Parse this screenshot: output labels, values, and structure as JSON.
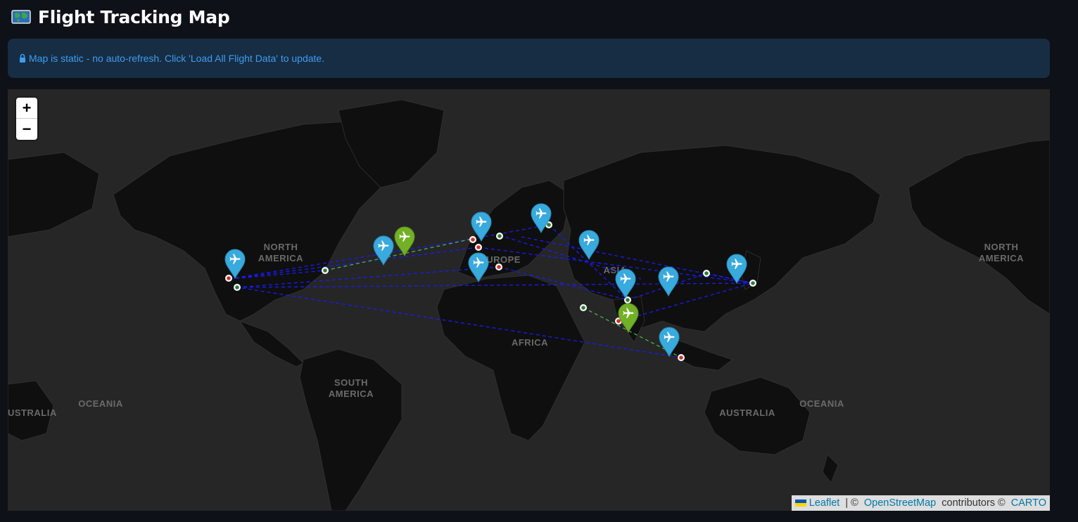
{
  "header": {
    "title": "Flight Tracking Map",
    "icon": "world-map-icon"
  },
  "info": {
    "text": "Map is static - no auto-refresh. Click 'Load All Flight Data' to update.",
    "icon": "lock-icon",
    "color": "#3d9df3"
  },
  "map": {
    "zoom_in_label": "+",
    "zoom_out_label": "−",
    "continent_labels": [
      {
        "lines": [
          "NORTH",
          "AMERICA"
        ],
        "name": "label-north-america-west"
      },
      {
        "lines": [
          "EUROPE"
        ],
        "name": "label-europe"
      },
      {
        "lines": [
          "ASIA"
        ],
        "name": "label-asia"
      },
      {
        "lines": [
          "AFRICA"
        ],
        "name": "label-africa"
      },
      {
        "lines": [
          "SOUTH",
          "AMERICA"
        ],
        "name": "label-south-america"
      },
      {
        "lines": [
          "OCEANIA"
        ],
        "name": "label-oceania-west"
      },
      {
        "lines": [
          "AUSTRALIA"
        ],
        "name": "label-australia"
      },
      {
        "lines": [
          "OCEANIA"
        ],
        "name": "label-oceania-east"
      },
      {
        "lines": [
          "NORTH",
          "AMERICA"
        ],
        "name": "label-north-america-east"
      },
      {
        "lines": [
          "USTRALIA"
        ],
        "name": "label-australia-west-edge"
      }
    ],
    "colors": {
      "route_active": "#1a1aff",
      "route_green": "#4caf50",
      "marker_blue": "#38aadd",
      "marker_green": "#72b026",
      "origin_dot": "#2e7d32",
      "dest_dot": "#d32f2f"
    }
  },
  "attribution": {
    "leaflet": "Leaflet",
    "separator": " | © ",
    "osm": "OpenStreetMap",
    "contributors": " contributors © ",
    "carto": "CARTO"
  }
}
